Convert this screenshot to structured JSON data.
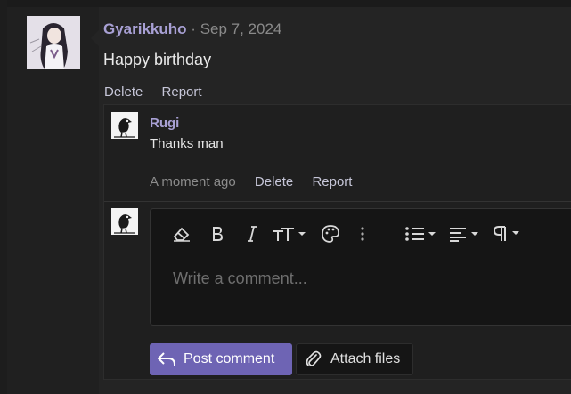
{
  "post": {
    "username": "Gyarikkuho",
    "separator": "·",
    "date": "Sep 7, 2024",
    "body": "Happy birthday",
    "actions": {
      "delete": "Delete",
      "report": "Report"
    }
  },
  "reply": {
    "username": "Rugi",
    "text": "Thanks man",
    "timestamp": "A moment ago",
    "actions": {
      "delete": "Delete",
      "report": "Report"
    }
  },
  "composer": {
    "placeholder": "Write a comment...",
    "toolbar_icons": [
      "eraser-icon",
      "bold-icon",
      "italic-icon",
      "text-size-icon",
      "palette-icon",
      "more-vertical-icon",
      "list-icon",
      "align-icon",
      "paragraph-icon"
    ],
    "post_button": "Post comment",
    "attach_button": "Attach files"
  },
  "colors": {
    "accent": "#6e64b4",
    "username": "#a8a0d4",
    "background": "#1b1b1b"
  }
}
